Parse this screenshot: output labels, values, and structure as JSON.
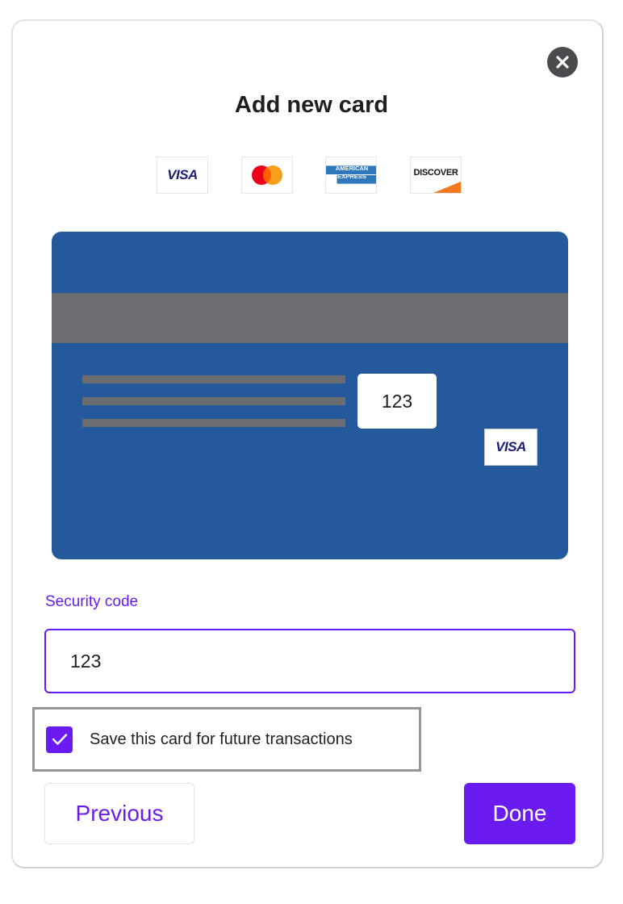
{
  "modal": {
    "title": "Add new card",
    "close_icon": "close-icon"
  },
  "brands": [
    {
      "name": "visa",
      "label": "VISA"
    },
    {
      "name": "mastercard",
      "label": ""
    },
    {
      "name": "american-express",
      "label": "AMERICAN EXPRESS"
    },
    {
      "name": "discover",
      "label": "DISCOVER"
    }
  ],
  "card_preview": {
    "cvv": "123",
    "brand_label": "VISA",
    "colors": {
      "card": "#24599c",
      "stripe": "#6c6d70"
    }
  },
  "security_code": {
    "label": "Security code",
    "value": "123"
  },
  "save_card": {
    "label": "Save this card for future transactions",
    "checked": true
  },
  "buttons": {
    "previous": "Previous",
    "done": "Done"
  },
  "colors": {
    "accent": "#6a1cf0"
  }
}
